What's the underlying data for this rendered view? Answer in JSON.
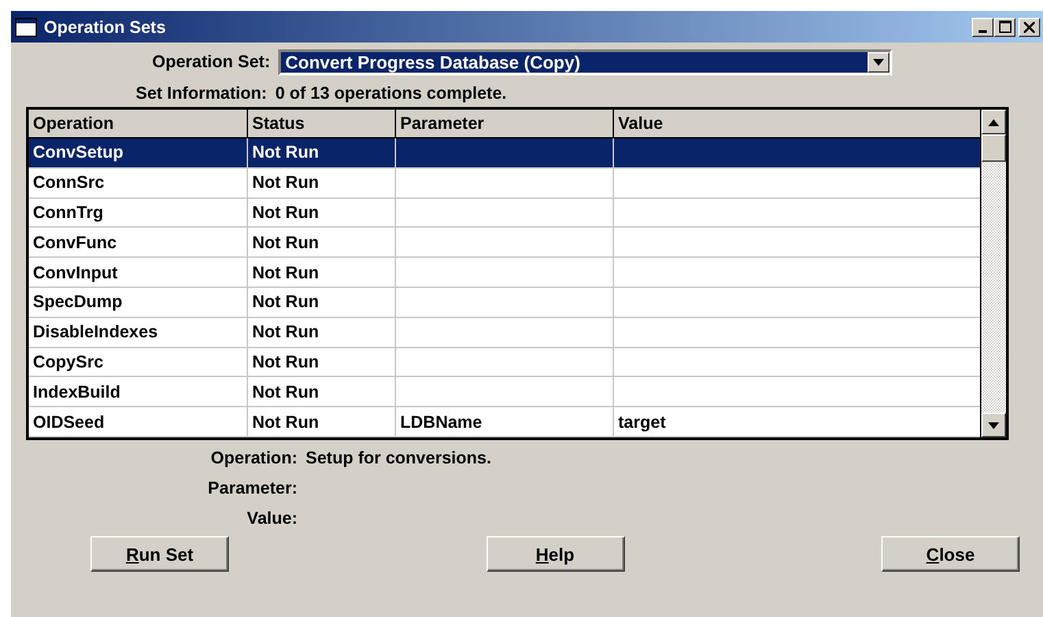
{
  "window": {
    "title": "Operation Sets"
  },
  "operation_set": {
    "label": "Operation Set:",
    "value": "Convert Progress Database (Copy)"
  },
  "set_information": {
    "label": "Set Information:",
    "value": "0 of 13 operations complete."
  },
  "table": {
    "columns": [
      "Operation",
      "Status",
      "Parameter",
      "Value"
    ],
    "rows": [
      {
        "operation": "ConvSetup",
        "status": "Not Run",
        "selected": true
      },
      {
        "operation": "ConnSrc",
        "status": "Not Run",
        "selected": false
      },
      {
        "operation": "ConnTrg",
        "status": "Not Run",
        "selected": false
      },
      {
        "operation": "ConvFunc",
        "status": "Not Run",
        "selected": false
      },
      {
        "operation": "ConvInput",
        "status": "Not Run",
        "selected": false
      },
      {
        "operation": "SpecDump",
        "status": "Not Run",
        "selected": false
      },
      {
        "operation": "DisableIndexes",
        "status": "Not Run",
        "selected": false
      },
      {
        "operation": "CopySrc",
        "status": "Not Run",
        "selected": false
      },
      {
        "operation": "IndexBuild",
        "status": "Not Run",
        "selected": false
      },
      {
        "operation": "OIDSeed",
        "status": "Not Run",
        "parameter": "LDBName",
        "value": "target",
        "selected": false
      }
    ]
  },
  "details": [
    {
      "label": "Operation:",
      "value": "Setup for conversions."
    },
    {
      "label": "Parameter:"
    },
    {
      "label": "Value:"
    }
  ],
  "buttons": [
    {
      "mnemonic": "R",
      "rest": "un Set"
    },
    {
      "mnemonic": "H",
      "rest": "elp"
    },
    {
      "mnemonic": "C",
      "rest": "lose"
    }
  ]
}
